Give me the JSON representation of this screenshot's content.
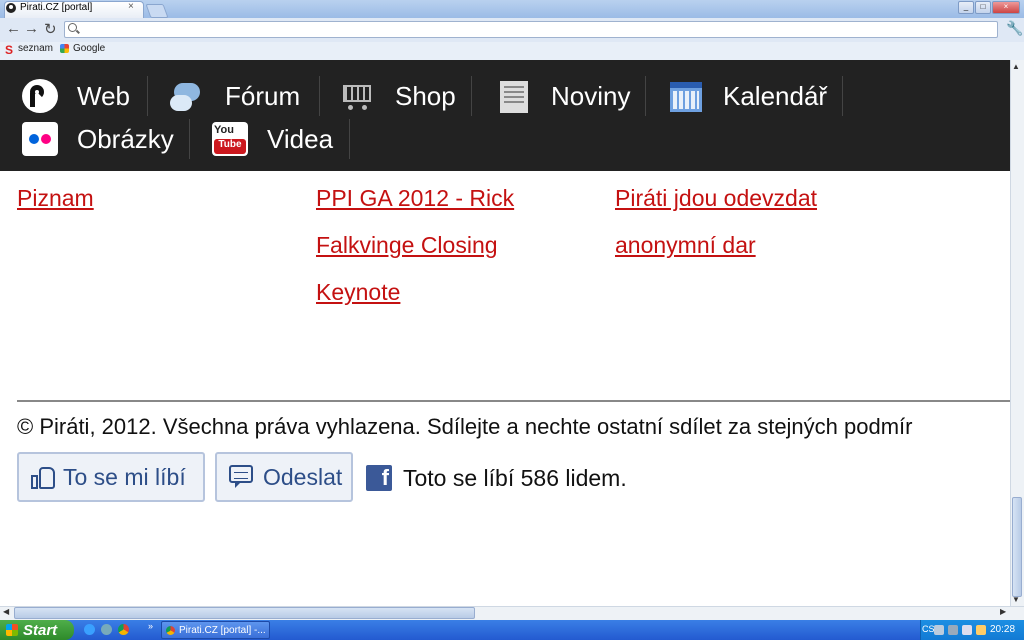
{
  "browser": {
    "tab_title": "Pirati.CZ [portal]",
    "tab_close": "×",
    "bookmarks": [
      "seznam",
      "Google"
    ]
  },
  "site_nav": {
    "items": [
      {
        "label": "Web",
        "icon": "pirate-logo-icon"
      },
      {
        "label": "Fórum",
        "icon": "chat-icon"
      },
      {
        "label": "Shop",
        "icon": "cart-icon"
      },
      {
        "label": "Noviny",
        "icon": "newspaper-icon"
      },
      {
        "label": "Kalendář",
        "icon": "calendar-icon"
      },
      {
        "label": "Obrázky",
        "icon": "flickr-icon"
      },
      {
        "label": "Videa",
        "icon": "youtube-icon"
      }
    ]
  },
  "articles": {
    "col1": "Piznam",
    "col2": "PPI GA 2012 - Rick Falkvinge Closing Keynote",
    "col3": "Piráti jdou odevzdat anonymní dar"
  },
  "footer": {
    "copyright": "© Piráti, 2012. Všechna práva vyhlazena. Sdílejte a nechte ostatní sdílet za stejných podmír",
    "like_label": "To se mi líbí",
    "send_label": "Odeslat",
    "fb_letter": "f",
    "fb_count": "Toto se líbí 586 lidem."
  },
  "taskbar": {
    "start_label": "Start",
    "more": "»",
    "window_label": "Pirati.CZ [portal] -...",
    "lang": "CS",
    "clock": "20:28"
  },
  "colors": {
    "nav_bg": "#222222",
    "link": "#c41111",
    "facebook": "#3b5998"
  }
}
